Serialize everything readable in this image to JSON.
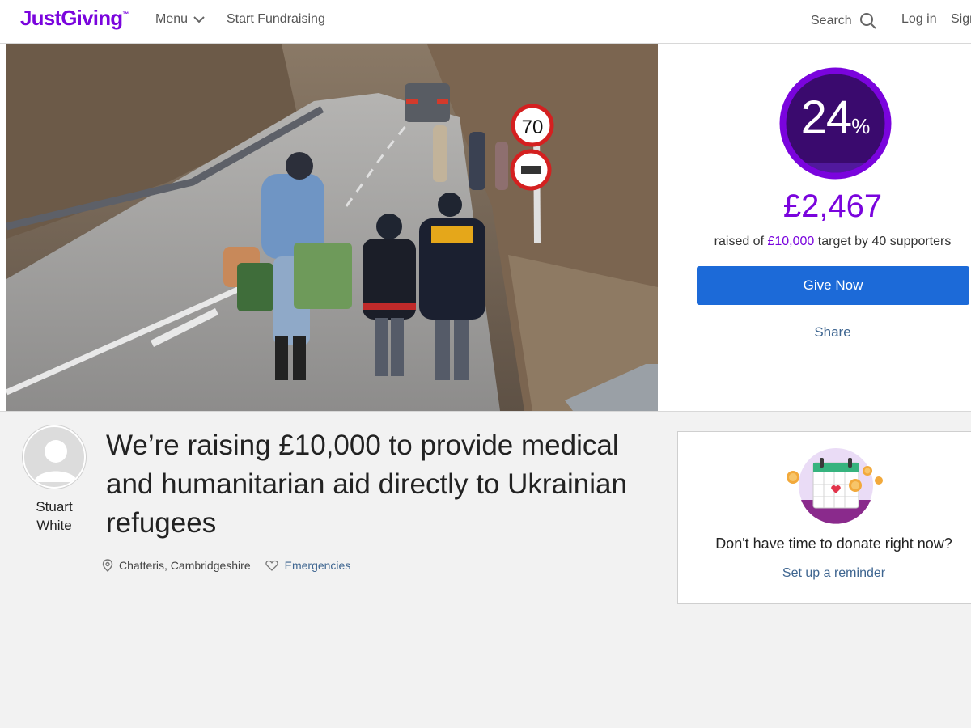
{
  "header": {
    "logo": "JustGiving",
    "logo_tm": "™",
    "menu_label": "Menu",
    "start_label": "Start Fundraising",
    "search_label": "Search",
    "login_label": "Log in",
    "signup_label": "Sign up"
  },
  "progress": {
    "percent": "24",
    "percent_sign": "%",
    "percent_value": 0.24,
    "raised": "£2,467",
    "raised_prefix": "raised of",
    "target": "£10,000",
    "target_suffix": "target by",
    "supporters": "40 supporters",
    "give_label": "Give Now",
    "share_label": "Share"
  },
  "page": {
    "owner_first": "Stuart",
    "owner_last": "White",
    "title": "We’re raising £10,000 to provide medical and humanitarian aid directly to Ukrainian refugees",
    "location": "Chatteris, Cambridgeshire",
    "category": "Emergencies"
  },
  "reminder": {
    "question": "Don't have time to donate right now?",
    "link": "Set up a reminder"
  },
  "hero_photo": {
    "speed_sign": "70"
  },
  "colors": {
    "brand": "#7a04dd",
    "button": "#1c6ad8",
    "link": "#3e6590",
    "ring_bg": "#3a0a6e"
  },
  "icons": [
    "chevron-down-icon",
    "search-icon",
    "location-pin-icon",
    "heart-icon",
    "calendar-reminder-icon"
  ]
}
